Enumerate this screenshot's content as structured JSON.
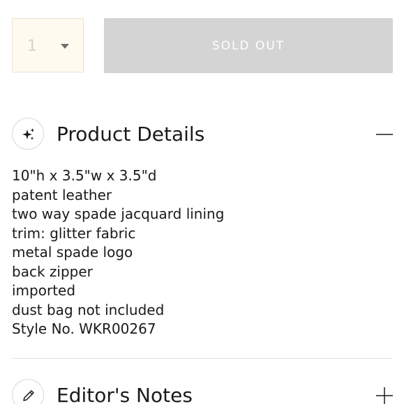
{
  "quantity": {
    "value": "1"
  },
  "sold_out_button": {
    "label": "SOLD OUT"
  },
  "product_details": {
    "title": "Product Details",
    "items": [
      "10\"h x 3.5\"w x 3.5\"d",
      "patent leather",
      "two way spade jacquard lining",
      "trim: glitter fabric",
      "metal spade logo",
      "back zipper",
      "imported",
      "dust bag not included",
      "Style No. WKR00267"
    ]
  },
  "editors_notes": {
    "title": "Editor's Notes"
  },
  "icons": {
    "product_details": "sparkle-icon",
    "product_details_toggle": "minus-icon",
    "editors_notes": "pencil-icon",
    "editors_notes_toggle": "plus-icon"
  },
  "colors": {
    "quantity_background": "#fffaf0",
    "sold_out_background": "#d4d4d4",
    "text": "#1a1a1a"
  }
}
